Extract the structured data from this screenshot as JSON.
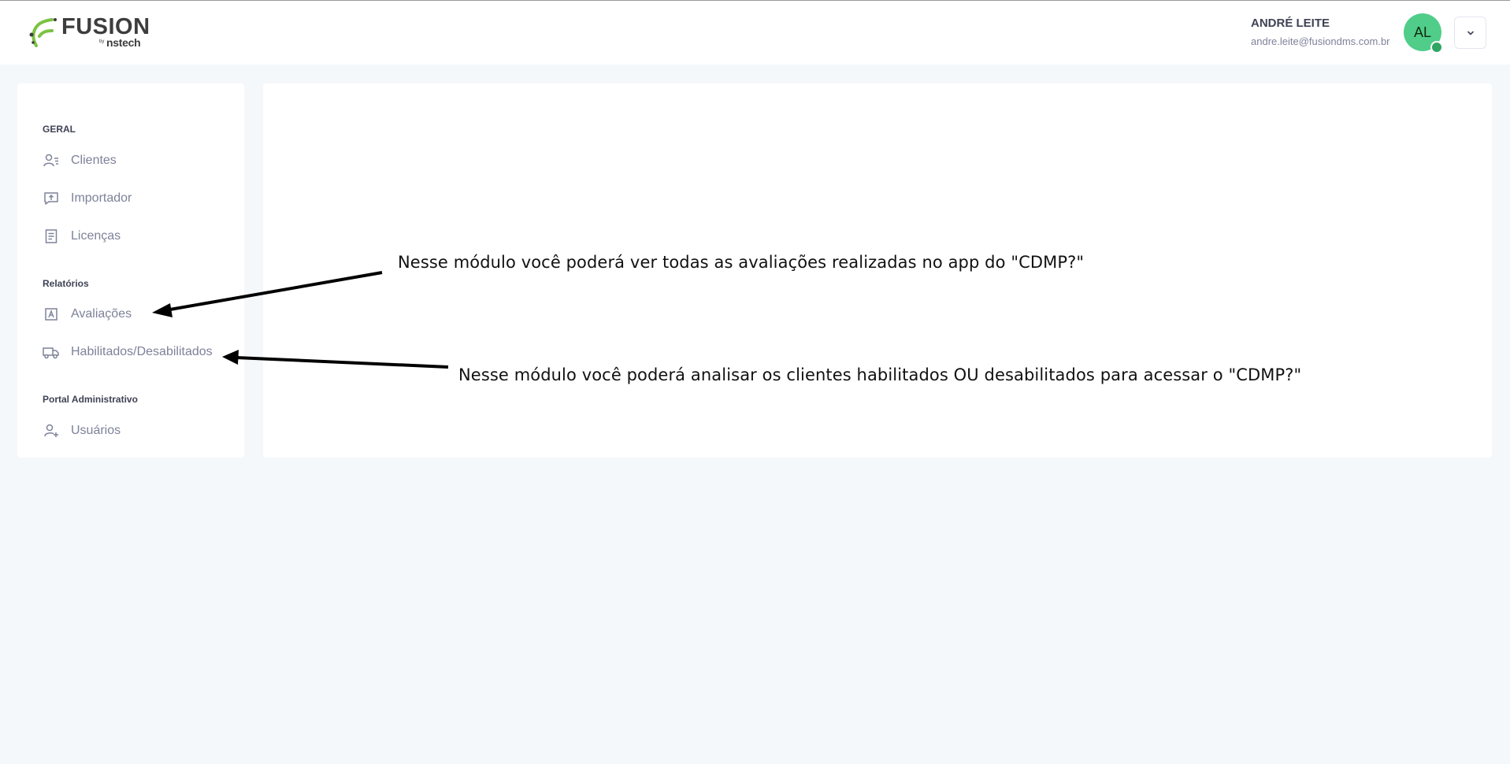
{
  "app": {
    "brand": "FUSION",
    "by": "by",
    "company": "nstech",
    "accent_color": "#7cc242"
  },
  "user": {
    "name": "ANDRÉ LEITE",
    "email": "andre.leite@fusiondms.com.br",
    "initials": "AL",
    "avatar_color": "#50cd89",
    "status": "online"
  },
  "sidebar": {
    "sections": [
      {
        "title": "GERAL",
        "items": [
          {
            "label": "Clientes",
            "icon": "user-list-icon"
          },
          {
            "label": "Importador",
            "icon": "upload-icon"
          },
          {
            "label": "Licenças",
            "icon": "document-icon"
          }
        ]
      },
      {
        "title": "Relatórios",
        "items": [
          {
            "label": "Avaliações",
            "icon": "evaluation-icon"
          },
          {
            "label": "Habilitados/Desabilitados",
            "icon": "truck-icon"
          }
        ]
      },
      {
        "title": "Portal Administrativo",
        "items": [
          {
            "label": "Usuários",
            "icon": "user-add-icon"
          }
        ]
      }
    ]
  },
  "annotations": [
    "Nesse módulo você poderá ver todas as avaliações realizadas no app do \"CDMP?\"",
    "Nesse módulo você poderá analisar os clientes habilitados OU desabilitados para acessar o \"CDMP?\""
  ]
}
